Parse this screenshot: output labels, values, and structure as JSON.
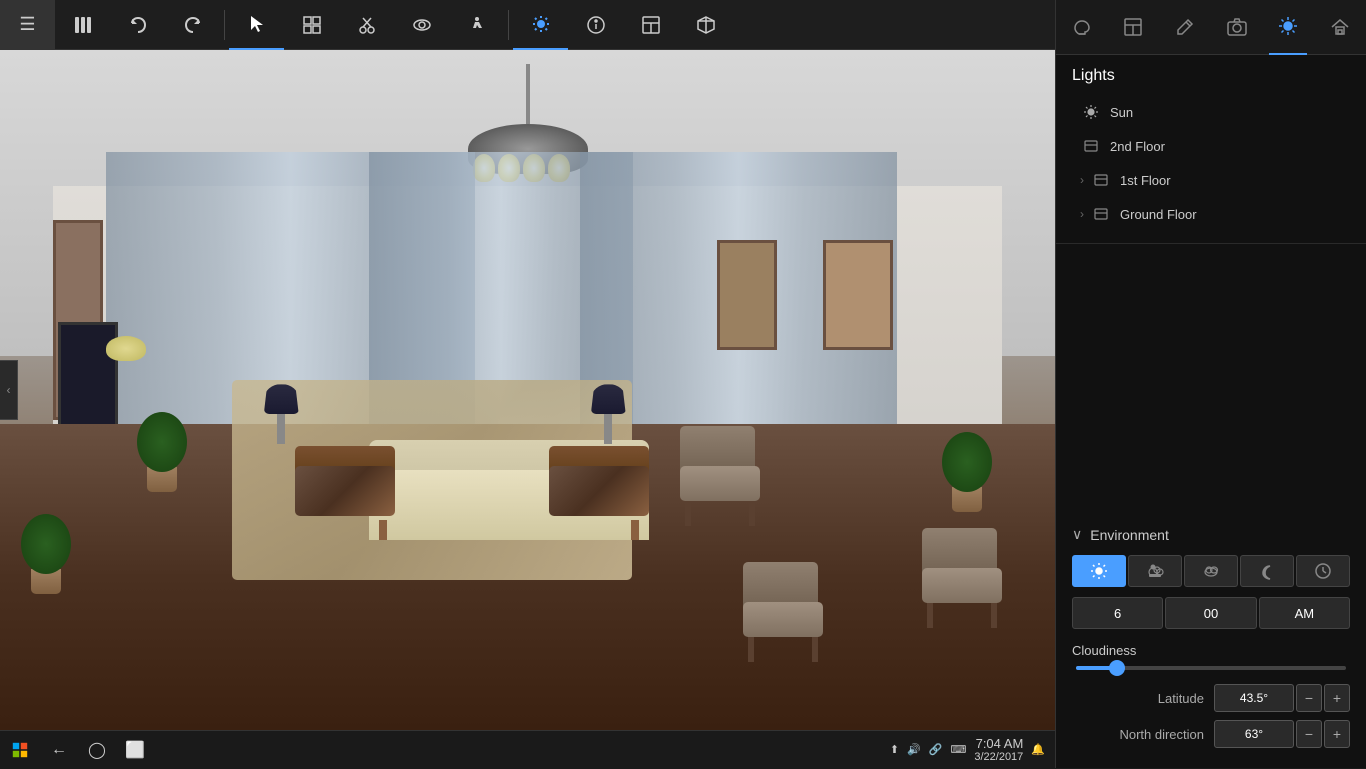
{
  "toolbar": {
    "icons": [
      {
        "name": "menu-icon",
        "symbol": "☰",
        "active": false
      },
      {
        "name": "library-icon",
        "symbol": "📚",
        "active": false
      },
      {
        "name": "undo-icon",
        "symbol": "↩",
        "active": false
      },
      {
        "name": "redo-icon",
        "symbol": "↪",
        "active": false
      },
      {
        "name": "select-icon",
        "symbol": "⬆",
        "active": true
      },
      {
        "name": "objects-icon",
        "symbol": "⊞",
        "active": false
      },
      {
        "name": "cut-icon",
        "symbol": "✂",
        "active": false
      },
      {
        "name": "view-icon",
        "symbol": "👁",
        "active": false
      },
      {
        "name": "walk-icon",
        "symbol": "🚶",
        "active": false
      },
      {
        "name": "sun-icon",
        "symbol": "☀",
        "active": true
      },
      {
        "name": "info-icon",
        "symbol": "ℹ",
        "active": false
      },
      {
        "name": "layout-icon",
        "symbol": "⬜",
        "active": false
      },
      {
        "name": "cube-icon",
        "symbol": "◻",
        "active": false
      }
    ]
  },
  "right_panel": {
    "tabs": [
      {
        "name": "paint-tab",
        "symbol": "🎨",
        "active": false
      },
      {
        "name": "layout-tab",
        "symbol": "⊞",
        "active": false
      },
      {
        "name": "edit-tab",
        "symbol": "✏",
        "active": false
      },
      {
        "name": "camera-tab",
        "symbol": "📷",
        "active": false
      },
      {
        "name": "sun-tab",
        "symbol": "☀",
        "active": true
      },
      {
        "name": "home-tab",
        "symbol": "🏠",
        "active": false
      }
    ],
    "lights": {
      "title": "Lights",
      "items": [
        {
          "id": "sun",
          "label": "Sun",
          "icon": "☀",
          "type": "sun",
          "has_chevron": false
        },
        {
          "id": "2nd-floor",
          "label": "2nd Floor",
          "icon": "⬜",
          "type": "floor",
          "has_chevron": false
        },
        {
          "id": "1st-floor",
          "label": "1st Floor",
          "icon": "⬜",
          "type": "floor",
          "has_chevron": true
        },
        {
          "id": "ground-floor",
          "label": "Ground Floor",
          "icon": "⬜",
          "type": "floor",
          "has_chevron": true
        }
      ]
    },
    "environment": {
      "title": "Environment",
      "expanded": true,
      "time_buttons": [
        {
          "id": "clear",
          "symbol": "☀",
          "active": true
        },
        {
          "id": "partly-cloudy",
          "symbol": "⛅",
          "active": false
        },
        {
          "id": "cloudy",
          "symbol": "☁",
          "active": false
        },
        {
          "id": "night",
          "symbol": "🌙",
          "active": false
        },
        {
          "id": "clock",
          "symbol": "⏰",
          "active": false
        }
      ],
      "time": {
        "hour": "6",
        "minutes": "00",
        "period": "AM"
      },
      "cloudiness_label": "Cloudiness",
      "cloudiness_percent": 15,
      "latitude_label": "Latitude",
      "latitude_value": "43.5°",
      "north_direction_label": "North direction",
      "north_direction_value": "63°"
    }
  },
  "taskbar": {
    "time": "7:04 AM",
    "date": "3/22/2017",
    "icons": [
      {
        "name": "system-icon",
        "symbol": "⬆"
      },
      {
        "name": "volume-icon",
        "symbol": "🔊"
      },
      {
        "name": "network-icon",
        "symbol": "🔗"
      },
      {
        "name": "keyboard-icon",
        "symbol": "⌨"
      },
      {
        "name": "notification-icon",
        "symbol": "🔔"
      }
    ]
  }
}
